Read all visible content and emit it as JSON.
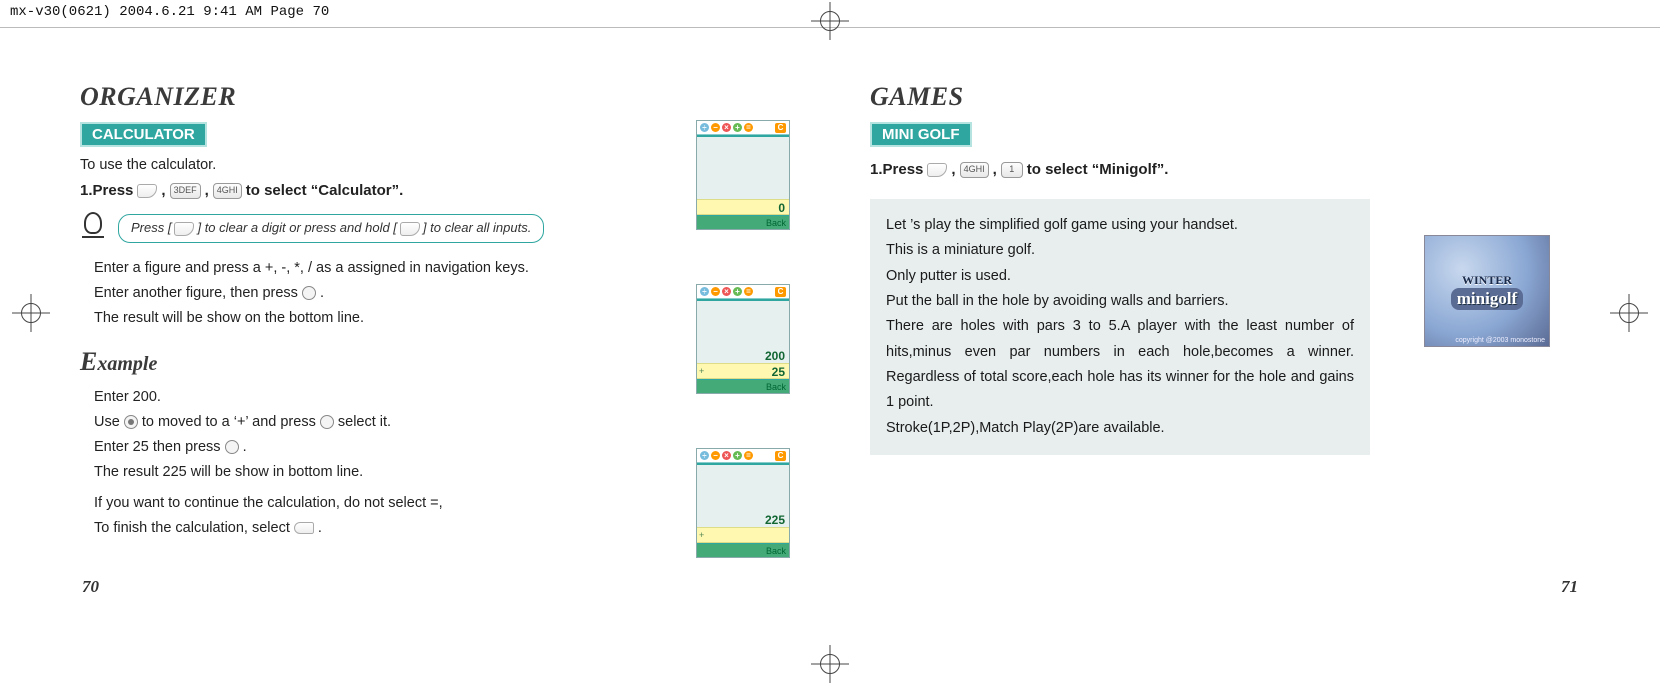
{
  "header": {
    "jobline": "mx-v30(0621)  2004.6.21  9:41 AM  Page 70"
  },
  "left_page": {
    "title": "ORGANIZER",
    "section": "CALCULATOR",
    "intro": "To use the calculator.",
    "step1_prefix": "1.Press",
    "step1_key1": "3DEF",
    "step1_key2": "4GHI",
    "step1_suffix": " to select “Calculator”.",
    "tip_p1": "Press [",
    "tip_p2": "] to clear a digit or press and hold [",
    "tip_p3": "] to clear all inputs.",
    "instr1": "Enter a figure and press a +, -, *, / as a assigned in navigation keys.",
    "instr2_a": "Enter another figure, then press ",
    "instr2_b": " .",
    "instr3": "The result will be show on the bottom line.",
    "example_heading": "Example",
    "ex1": "Enter 200.",
    "ex2_a": "Use ",
    "ex2_b": " to moved to a ‘+’ and press ",
    "ex2_c": " select it.",
    "ex3_a": "Enter 25 then press ",
    "ex3_b": " .",
    "ex4": "The result 225 will be show in bottom line.",
    "ex5": "If you want to continue the calculation, do not select =,",
    "ex6_a": "To finish the calculation, select ",
    "ex6_b": ".",
    "page_no": "70",
    "calc_icons": {
      "div": "÷",
      "sub": "−",
      "mul": "×",
      "add": "+",
      "eq": "=",
      "clr": "C"
    },
    "shots": {
      "back": "Back",
      "s1_val": "0",
      "s2_l1": "200",
      "s2_l2": "25",
      "s2_op": "+",
      "s3_val": "225",
      "s3_op": "+"
    }
  },
  "right_page": {
    "title": "GAMES",
    "section": "MINI GOLF",
    "step1_prefix": "1.Press",
    "step1_key1": "4GHI",
    "step1_key2": "1",
    "step1_suffix": " to select “Minigolf”.",
    "panel": {
      "l1": "Let ’s play the simplified golf game using your handset.",
      "l2": "This is a miniature golf.",
      "l3": "Only putter is used.",
      "l4": "Put the ball in the hole by avoiding walls and barriers.",
      "l5": "There are holes with pars 3 to 5.A player with the least number of hits,minus even par numbers in each hole,becomes a winner. Regardless of total score,each hole has its winner for the hole and gains 1 point.",
      "l6": "Stroke(1P,2P),Match Play(2P)are available."
    },
    "thumb": {
      "top": "WINTER",
      "main": "minigolf",
      "cp": "copyright @2003 monostone"
    },
    "page_no": "71"
  }
}
